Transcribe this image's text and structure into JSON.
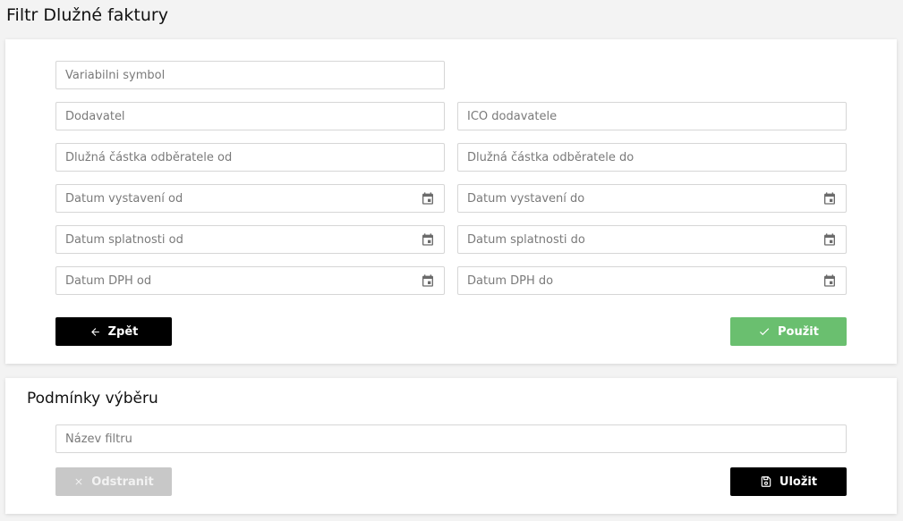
{
  "page": {
    "title": "Filtr Dlužné faktury"
  },
  "filter": {
    "variable_symbol": {
      "placeholder": "Variabilni symbol",
      "value": ""
    },
    "supplier": {
      "placeholder": "Dodavatel",
      "value": ""
    },
    "supplier_ico": {
      "placeholder": "IČO dodavatele",
      "value": ""
    },
    "debt_amount_from": {
      "placeholder": "Dlužná částka odběratele od",
      "value": ""
    },
    "debt_amount_to": {
      "placeholder": "Dlužná částka odběratele do",
      "value": ""
    },
    "issue_date_from": {
      "placeholder": "Datum vystavení od",
      "value": ""
    },
    "issue_date_to": {
      "placeholder": "Datum vystavení do",
      "value": ""
    },
    "due_date_from": {
      "placeholder": "Datum splatnosti od",
      "value": ""
    },
    "due_date_to": {
      "placeholder": "Datum splatnosti do",
      "value": ""
    },
    "vat_date_from": {
      "placeholder": "Datum DPH od",
      "value": ""
    },
    "vat_date_to": {
      "placeholder": "Datum DPH do",
      "value": ""
    },
    "back_label": "Zpět",
    "apply_label": "Použit"
  },
  "conditions": {
    "title": "Podmínky výběru",
    "filter_name": {
      "placeholder": "Název filtru",
      "value": ""
    },
    "remove_label": "Odstranit",
    "save_label": "Uložit"
  },
  "icons": {
    "calendar": "calendar-icon",
    "back": "arrow-left-icon",
    "apply": "check-icon",
    "remove": "close-icon",
    "save": "floppy-disk-icon"
  },
  "colors": {
    "primary": "#000000",
    "success": "#6abf6f",
    "disabled": "#c8c8c8",
    "background": "#f3f3f3"
  }
}
